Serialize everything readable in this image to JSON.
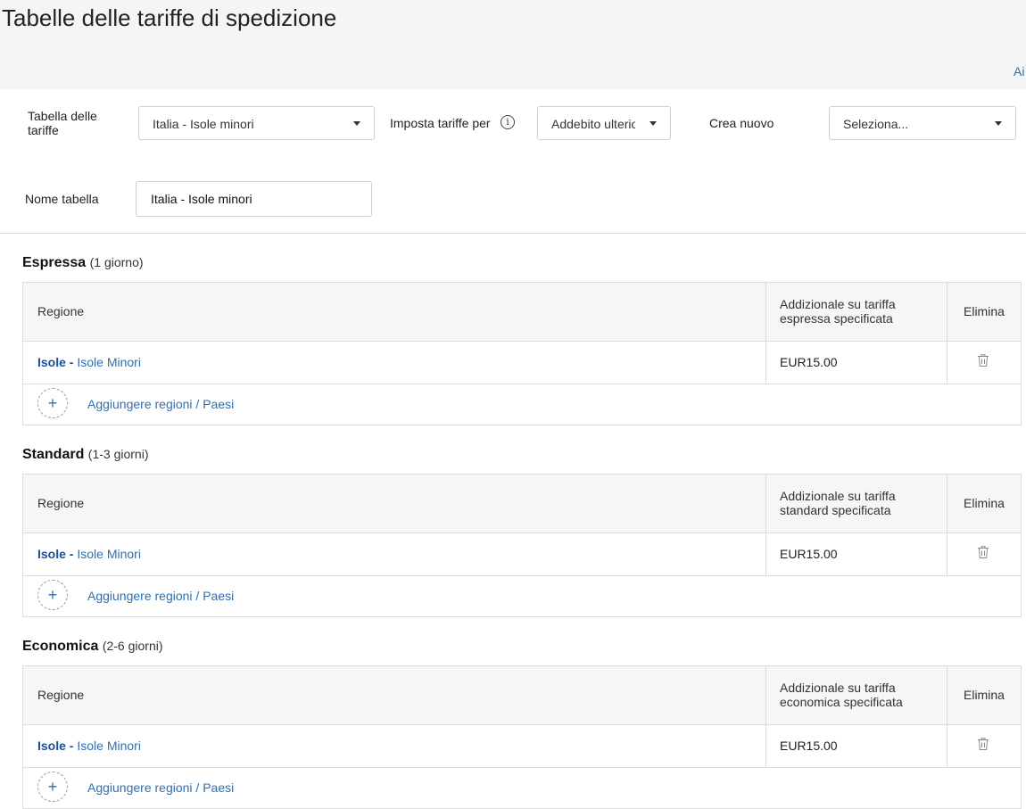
{
  "page": {
    "title": "Tabelle delle tariffe di spedizione",
    "help_link": "Ai"
  },
  "form": {
    "rate_table_label": "Tabella delle tariffe",
    "rate_table_value": "Italia - Isole minori",
    "set_rates_label": "Imposta tariffe per",
    "set_rates_value": "Addebito ulteriore",
    "create_new_label": "Crea nuovo",
    "create_new_value": "Seleziona...",
    "table_name_label": "Nome tabella",
    "table_name_value": "Italia - Isole minori"
  },
  "sections": [
    {
      "title": "Espressa",
      "subtitle": "(1 giorno)",
      "col_region": "Regione",
      "col_rate": "Addizionale su tariffa espressa specificata",
      "col_delete": "Elimina",
      "rows": [
        {
          "region_bold": "Isole -",
          "region": "Isole Minori",
          "amount": "EUR15.00"
        }
      ],
      "add_label": "Aggiungere regioni / Paesi"
    },
    {
      "title": "Standard",
      "subtitle": "(1-3 giorni)",
      "col_region": "Regione",
      "col_rate": "Addizionale su tariffa standard specificata",
      "col_delete": "Elimina",
      "rows": [
        {
          "region_bold": "Isole -",
          "region": "Isole Minori",
          "amount": "EUR15.00"
        }
      ],
      "add_label": "Aggiungere regioni / Paesi"
    },
    {
      "title": "Economica",
      "subtitle": "(2-6 giorni)",
      "col_region": "Regione",
      "col_rate": "Addizionale su tariffa economica specificata",
      "col_delete": "Elimina",
      "rows": [
        {
          "region_bold": "Isole -",
          "region": "Isole Minori",
          "amount": "EUR15.00"
        }
      ],
      "add_label": "Aggiungere regioni / Paesi"
    }
  ],
  "icons": {
    "info": "info-icon",
    "dropdown": "caret-down-icon",
    "delete": "trash-icon",
    "add": "plus-icon"
  },
  "colors": {
    "link": "#2f6fb0",
    "link_bold": "#1a4f96",
    "header_bg": "#f5f5f5",
    "border": "#dcdcdc"
  }
}
